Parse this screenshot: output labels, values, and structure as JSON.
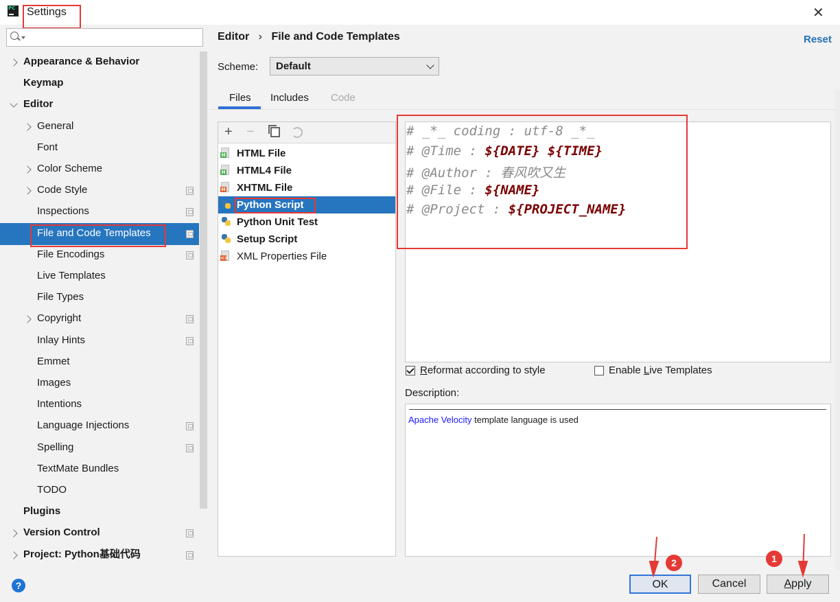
{
  "window": {
    "title": "Settings",
    "close_glyph": "✕",
    "icon_text": "PC"
  },
  "sidebar": {
    "search_value": "",
    "items": [
      {
        "label": "Appearance & Behavior",
        "bold": true,
        "expander": "right",
        "indent": 0
      },
      {
        "label": "Keymap",
        "bold": true,
        "expander": "none",
        "indent": 0
      },
      {
        "label": "Editor",
        "bold": true,
        "expander": "down",
        "indent": 0
      },
      {
        "label": "General",
        "bold": false,
        "expander": "right",
        "indent": 1
      },
      {
        "label": "Font",
        "bold": false,
        "expander": "none",
        "indent": 1
      },
      {
        "label": "Color Scheme",
        "bold": false,
        "expander": "right",
        "indent": 1
      },
      {
        "label": "Code Style",
        "bold": false,
        "expander": "right",
        "indent": 1,
        "project_icon": true
      },
      {
        "label": "Inspections",
        "bold": false,
        "expander": "none",
        "indent": 1,
        "project_icon": true
      },
      {
        "label": "File and Code Templates",
        "bold": false,
        "expander": "none",
        "indent": 1,
        "project_icon": true,
        "selected": true
      },
      {
        "label": "File Encodings",
        "bold": false,
        "expander": "none",
        "indent": 1,
        "project_icon": true
      },
      {
        "label": "Live Templates",
        "bold": false,
        "expander": "none",
        "indent": 1
      },
      {
        "label": "File Types",
        "bold": false,
        "expander": "none",
        "indent": 1
      },
      {
        "label": "Copyright",
        "bold": false,
        "expander": "right",
        "indent": 1,
        "project_icon": true
      },
      {
        "label": "Inlay Hints",
        "bold": false,
        "expander": "none",
        "indent": 1,
        "project_icon": true
      },
      {
        "label": "Emmet",
        "bold": false,
        "expander": "none",
        "indent": 1
      },
      {
        "label": "Images",
        "bold": false,
        "expander": "none",
        "indent": 1
      },
      {
        "label": "Intentions",
        "bold": false,
        "expander": "none",
        "indent": 1
      },
      {
        "label": "Language Injections",
        "bold": false,
        "expander": "none",
        "indent": 1,
        "project_icon": true
      },
      {
        "label": "Spelling",
        "bold": false,
        "expander": "none",
        "indent": 1,
        "project_icon": true
      },
      {
        "label": "TextMate Bundles",
        "bold": false,
        "expander": "none",
        "indent": 1
      },
      {
        "label": "TODO",
        "bold": false,
        "expander": "none",
        "indent": 1
      },
      {
        "label": "Plugins",
        "bold": true,
        "expander": "none",
        "indent": 0
      },
      {
        "label": "Version Control",
        "bold": true,
        "expander": "right",
        "indent": 0,
        "project_icon": true
      },
      {
        "label": "Project: Python基础代码",
        "bold": true,
        "expander": "right",
        "indent": 0,
        "project_icon": true
      }
    ]
  },
  "header": {
    "breadcrumb_parent": "Editor",
    "breadcrumb_sep": "›",
    "breadcrumb_current": "File and Code Templates",
    "reset_label": "Reset"
  },
  "scheme": {
    "label": "Scheme:",
    "value": "Default"
  },
  "tabs": [
    {
      "label": "Files",
      "active": true,
      "disabled": false
    },
    {
      "label": "Includes",
      "active": false,
      "disabled": false
    },
    {
      "label": "Code",
      "active": false,
      "disabled": true
    }
  ],
  "toolbar": {
    "add": "+",
    "remove": "−"
  },
  "templates": [
    {
      "label": "HTML File",
      "bold": true,
      "icon": "html",
      "tag_color": "#4caf50",
      "tag": "H"
    },
    {
      "label": "HTML4 File",
      "bold": true,
      "icon": "html",
      "tag_color": "#4caf50",
      "tag": "H"
    },
    {
      "label": "XHTML File",
      "bold": true,
      "icon": "html",
      "tag_color": "#e0622d",
      "tag": "H"
    },
    {
      "label": "Python Script",
      "bold": true,
      "icon": "python",
      "selected": true
    },
    {
      "label": "Python Unit Test",
      "bold": true,
      "icon": "python"
    },
    {
      "label": "Setup Script",
      "bold": true,
      "icon": "python"
    },
    {
      "label": "XML Properties File",
      "bold": false,
      "icon": "xml",
      "tag_color": "#e0622d",
      "tag": "<>"
    }
  ],
  "code": [
    [
      {
        "t": "# _*_ coding : utf-8 _*_",
        "v": false
      }
    ],
    [
      {
        "t": "# @Time : ",
        "v": false
      },
      {
        "t": "${DATE}",
        "v": true
      },
      {
        "t": " ",
        "v": false
      },
      {
        "t": "${TIME}",
        "v": true
      }
    ],
    [
      {
        "t": "# @Author : 春风吹又生",
        "v": false
      }
    ],
    [
      {
        "t": "# @File : ",
        "v": false
      },
      {
        "t": "${NAME}",
        "v": true
      }
    ],
    [
      {
        "t": "# @Project : ",
        "v": false
      },
      {
        "t": "${PROJECT_NAME}",
        "v": true
      }
    ]
  ],
  "options": {
    "reformat_label_pre": "",
    "reformat_mnemonic": "R",
    "reformat_label_post": "eformat according to style",
    "reformat_checked": true,
    "live_label_pre": "Enable ",
    "live_mnemonic": "L",
    "live_label_post": "ive Templates",
    "live_checked": false
  },
  "description": {
    "label": "Description:",
    "link_text": "Apache Velocity",
    "text": " template language is used"
  },
  "buttons": {
    "help": "?",
    "ok": "OK",
    "cancel": "Cancel",
    "apply_mnemonic": "A",
    "apply_rest": "pply"
  },
  "annotations": {
    "badge_ok": "2",
    "badge_apply": "1",
    "color": "#e53935"
  }
}
